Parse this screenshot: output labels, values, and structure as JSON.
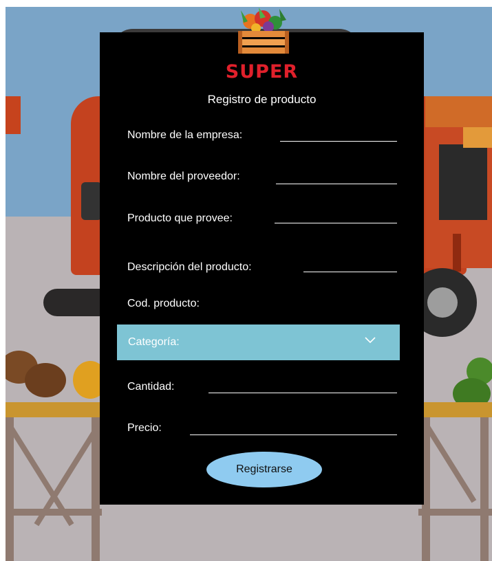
{
  "brand": {
    "name": "SUPER"
  },
  "form": {
    "title": "Registro de producto",
    "fields": {
      "empresa": "Nombre de la empresa:",
      "proveedor": "Nombre del proveedor:",
      "producto": "Producto que provee:",
      "descripcion": "Descripción del producto:",
      "codigo": "Cod. producto:",
      "cantidad": "Cantidad:",
      "precio": "Precio:"
    },
    "category": {
      "selected": "Categoría:",
      "icon": "chevron-down-icon"
    },
    "submit_label": "Registrarse"
  },
  "colors": {
    "card": "#000000",
    "brand": "#e0202b",
    "select": "#7ec4d4",
    "button": "#8fcbf0"
  }
}
